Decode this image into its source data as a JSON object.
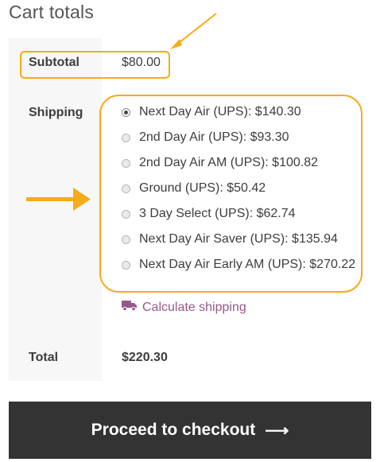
{
  "heading": "Cart totals",
  "subtotal": {
    "label": "Subtotal",
    "value": "$80.00"
  },
  "shipping": {
    "label": "Shipping",
    "options": [
      {
        "label": "Next Day Air (UPS): $140.30",
        "selected": true
      },
      {
        "label": "2nd Day Air (UPS): $93.30",
        "selected": false
      },
      {
        "label": "2nd Day Air AM (UPS): $100.82",
        "selected": false
      },
      {
        "label": "Ground (UPS): $50.42",
        "selected": false
      },
      {
        "label": "3 Day Select (UPS): $62.74",
        "selected": false
      },
      {
        "label": "Next Day Air Saver (UPS): $135.94",
        "selected": false
      },
      {
        "label": "Next Day Air Early AM (UPS): $270.22",
        "selected": false
      }
    ],
    "calculate_link": "Calculate shipping",
    "calculate_icon": "truck-icon"
  },
  "total": {
    "label": "Total",
    "value": "$220.30"
  },
  "checkout": {
    "label": "Proceed to checkout",
    "arrow": "⟶"
  },
  "colors": {
    "highlight": "#f7ab1b",
    "link": "#96588a",
    "button_bg": "#333333"
  }
}
